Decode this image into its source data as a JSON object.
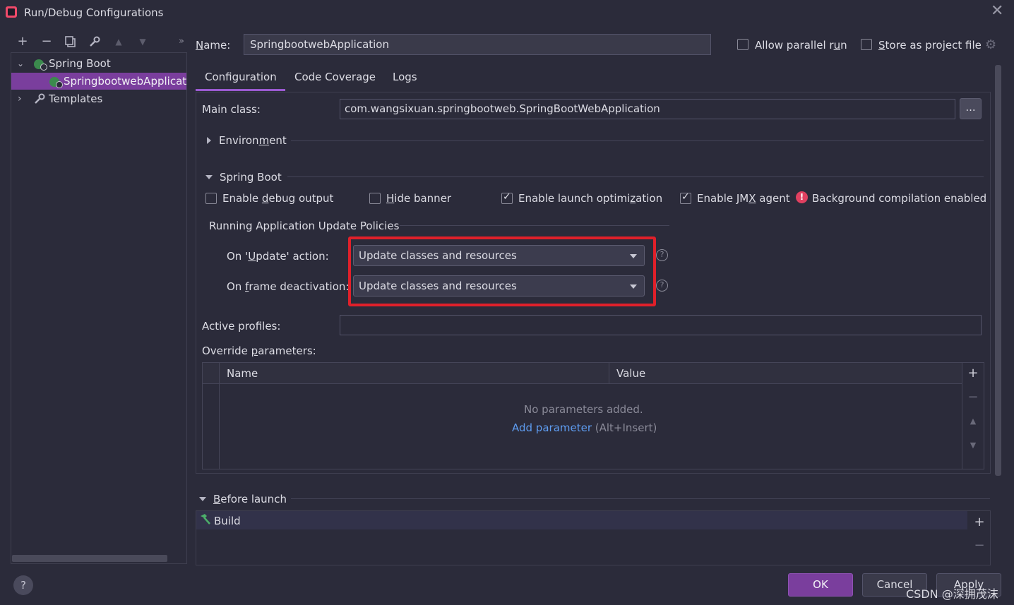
{
  "window": {
    "title": "Run/Debug Configurations"
  },
  "toolbar": {
    "add": "+",
    "remove": "−",
    "more": "»"
  },
  "tree": {
    "spring_boot": "Spring Boot",
    "app": "SpringbootwebApplication",
    "templates": "Templates"
  },
  "name": {
    "label_pre": "",
    "label_u": "N",
    "label_post": "ame:",
    "value": "SpringbootwebApplication"
  },
  "allow_parallel": {
    "pre": "Allow parallel r",
    "u": "u",
    "post": "n",
    "checked": false
  },
  "store_project": {
    "pre": "",
    "u": "S",
    "post": "tore as project file",
    "checked": false
  },
  "tabs": [
    "Configuration",
    "Code Coverage",
    "Logs"
  ],
  "main_class": {
    "label": "Main class:",
    "value": "com.wangsixuan.springbootweb.SpringBootWebApplication",
    "browse": "..."
  },
  "environment": {
    "pre": "Environ",
    "u": "m",
    "post": "ent"
  },
  "spring_boot_section": {
    "label": "Spring Boot"
  },
  "options": {
    "debug": {
      "pre": "Enable ",
      "u": "d",
      "post": "ebug output",
      "checked": false
    },
    "banner": {
      "pre": "",
      "u": "H",
      "post": "ide banner",
      "checked": false
    },
    "launch": {
      "pre": "Enable launch optimi",
      "u": "z",
      "post": "ation",
      "checked": true
    },
    "jmx": {
      "pre": "Enable JM",
      "u": "X",
      "post": " agent",
      "checked": true
    },
    "bg_compile": "Background compilation enabled"
  },
  "policies": {
    "title": "Running Application Update Policies",
    "update": {
      "pre": "On '",
      "u": "U",
      "post": "pdate' action:",
      "value": "Update classes and resources"
    },
    "frame": {
      "pre": "On ",
      "u": "f",
      "post": "rame deactivation:",
      "value": "Update classes and resources"
    }
  },
  "active_profiles": {
    "label": "Active profiles:",
    "value": ""
  },
  "override": {
    "pre": "Override ",
    "u": "p",
    "post": "arameters:",
    "columns": [
      "Name",
      "Value"
    ],
    "empty": "No parameters added.",
    "add_link": "Add parameter",
    "add_hint": " (Alt+Insert)"
  },
  "before_launch": {
    "pre": "",
    "u": "B",
    "post": "efore launch",
    "item": "Build"
  },
  "buttons": {
    "ok": "OK",
    "cancel": "Cancel",
    "apply": "Apply",
    "help": "?"
  },
  "watermark": "CSDN @深拥茂沫",
  "colors": {
    "accent": "#7a3e9d",
    "highlight_box": "#e0202a",
    "link": "#5e9cf0",
    "ok_button": "#7a3e9d"
  }
}
